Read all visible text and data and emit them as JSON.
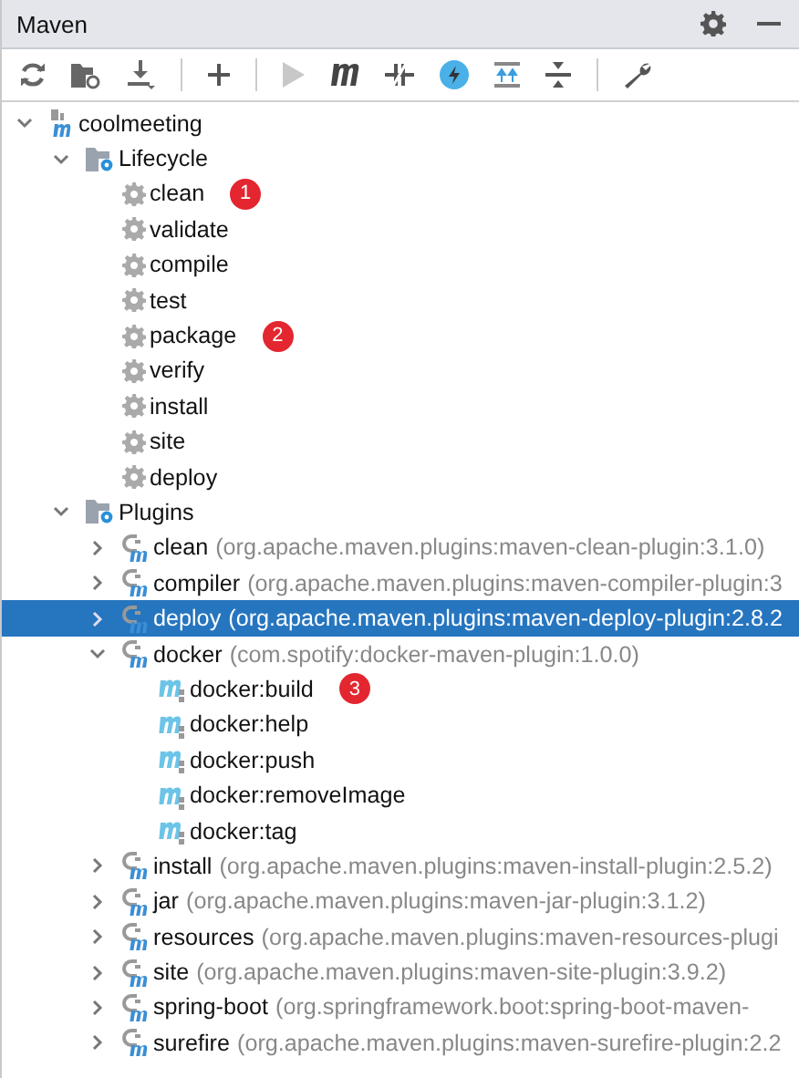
{
  "window": {
    "title": "Maven"
  },
  "tree": [
    {
      "kind": "project",
      "label": "coolmeeting",
      "expanded": true,
      "selected": false,
      "children": [
        {
          "kind": "folder",
          "label": "Lifecycle",
          "expanded": true,
          "selected": false,
          "children": [
            {
              "kind": "phase",
              "label": "clean",
              "selected": false,
              "badge": "1"
            },
            {
              "kind": "phase",
              "label": "validate",
              "selected": false
            },
            {
              "kind": "phase",
              "label": "compile",
              "selected": false
            },
            {
              "kind": "phase",
              "label": "test",
              "selected": false
            },
            {
              "kind": "phase",
              "label": "package",
              "selected": false,
              "badge": "2"
            },
            {
              "kind": "phase",
              "label": "verify",
              "selected": false
            },
            {
              "kind": "phase",
              "label": "install",
              "selected": false
            },
            {
              "kind": "phase",
              "label": "site",
              "selected": false
            },
            {
              "kind": "phase",
              "label": "deploy",
              "selected": false
            }
          ]
        },
        {
          "kind": "folder",
          "label": "Plugins",
          "expanded": true,
          "selected": false,
          "children": [
            {
              "kind": "plugin",
              "label": "clean",
              "detail": "(org.apache.maven.plugins:maven-clean-plugin:3.1.0)",
              "expanded": false,
              "selected": false
            },
            {
              "kind": "plugin",
              "label": "compiler",
              "detail": "(org.apache.maven.plugins:maven-compiler-plugin:3",
              "expanded": false,
              "selected": false
            },
            {
              "kind": "plugin",
              "label": "deploy",
              "detail": "(org.apache.maven.plugins:maven-deploy-plugin:2.8.2",
              "expanded": false,
              "selected": true
            },
            {
              "kind": "plugin",
              "label": "docker",
              "detail": "(com.spotify:docker-maven-plugin:1.0.0)",
              "expanded": true,
              "selected": false,
              "children": [
                {
                  "kind": "goal",
                  "label": "docker:build",
                  "selected": false,
                  "badge": "3"
                },
                {
                  "kind": "goal",
                  "label": "docker:help",
                  "selected": false
                },
                {
                  "kind": "goal",
                  "label": "docker:push",
                  "selected": false
                },
                {
                  "kind": "goal",
                  "label": "docker:removeImage",
                  "selected": false
                },
                {
                  "kind": "goal",
                  "label": "docker:tag",
                  "selected": false
                }
              ]
            },
            {
              "kind": "plugin",
              "label": "install",
              "detail": "(org.apache.maven.plugins:maven-install-plugin:2.5.2)",
              "expanded": false,
              "selected": false
            },
            {
              "kind": "plugin",
              "label": "jar",
              "detail": "(org.apache.maven.plugins:maven-jar-plugin:3.1.2)",
              "expanded": false,
              "selected": false
            },
            {
              "kind": "plugin",
              "label": "resources",
              "detail": "(org.apache.maven.plugins:maven-resources-plugi",
              "expanded": false,
              "selected": false
            },
            {
              "kind": "plugin",
              "label": "site",
              "detail": "(org.apache.maven.plugins:maven-site-plugin:3.9.2)",
              "expanded": false,
              "selected": false
            },
            {
              "kind": "plugin",
              "label": "spring-boot",
              "detail": "(org.springframework.boot:spring-boot-maven-",
              "expanded": false,
              "selected": false
            },
            {
              "kind": "plugin",
              "label": "surefire",
              "detail": "(org.apache.maven.plugins:maven-surefire-plugin:2.2",
              "expanded": false,
              "selected": false
            }
          ]
        }
      ]
    }
  ]
}
